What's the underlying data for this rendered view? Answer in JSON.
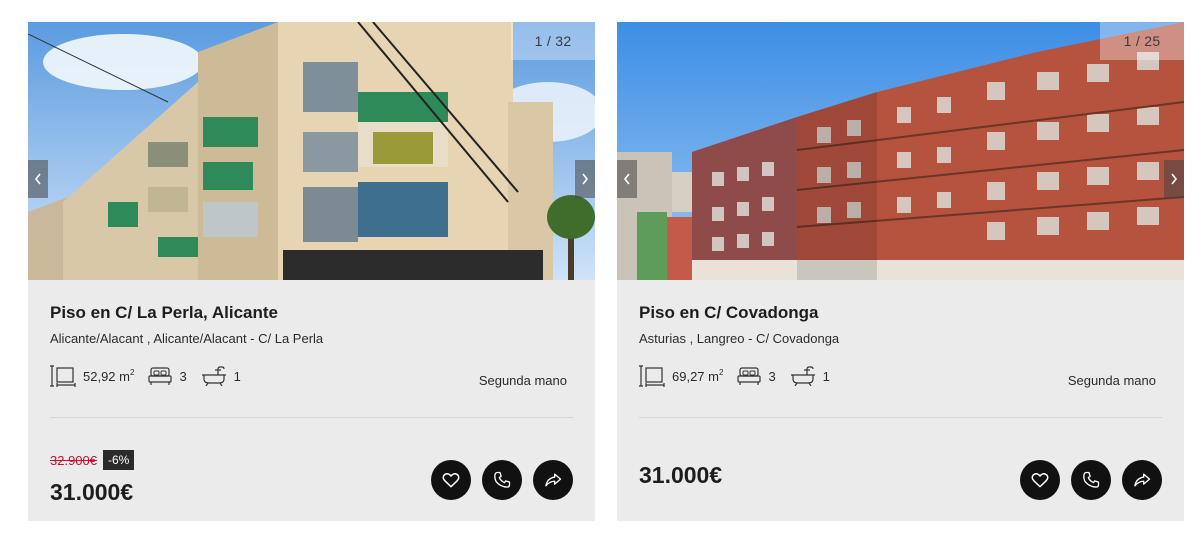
{
  "listings": [
    {
      "photo_counter": "1 / 32",
      "title": "Piso en C/ La Perla, Alicante",
      "address": "Alicante/Alacant , Alicante/Alacant - C/ La Perla",
      "area": "52,92 m",
      "area_unit_sup": "2",
      "bedrooms": "3",
      "bathrooms": "1",
      "condition": "Segunda mano",
      "old_price": "32.900€",
      "discount": "-6%",
      "price": "31.000€"
    },
    {
      "photo_counter": "1 / 25",
      "title": "Piso en C/ Covadonga",
      "address": "Asturias , Langreo - C/ Covadonga",
      "area": "69,27 m",
      "area_unit_sup": "2",
      "bedrooms": "3",
      "bathrooms": "1",
      "condition": "Segunda mano",
      "price": "31.000€"
    }
  ],
  "icons": {
    "area": "area-icon",
    "bed": "bed-icon",
    "bath": "bath-icon",
    "favorite": "heart-icon",
    "call": "phone-icon",
    "share": "share-icon",
    "prev": "chevron-left-icon",
    "next": "chevron-right-icon"
  },
  "colors": {
    "card_bg": "#ebebeb",
    "old_price": "#c8102e",
    "discount_bg": "#2b2b2b",
    "action_bg": "#111111"
  }
}
